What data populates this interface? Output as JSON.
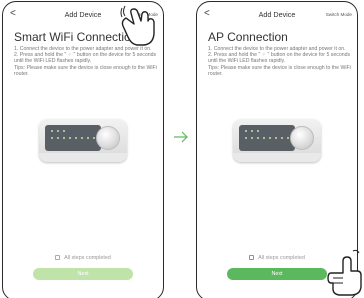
{
  "left_screen": {
    "back_label": "<",
    "title": "Add Device",
    "switch_mode_label": "Switch Mode",
    "heading": "Smart WiFi Connection",
    "instructions": "1. Connect the device to the power adapter and power it on.\n2. Press and hold the \" ⁘ \" button on the device for 5 seconds until the WiFi LED flashes rapidly.\nTips: Please make sure the device is close enough to the WiFi router.",
    "checkbox_label": "All steps completed",
    "checkbox_checked": false,
    "next_label": "Next",
    "next_enabled": false
  },
  "right_screen": {
    "back_label": "<",
    "title": "Add Device",
    "switch_mode_label": "Switch Mode",
    "heading": "AP Connection",
    "instructions": "1. Connect the device to the power adapter and power it on.\n2. Press and hold the \" ⁘ \" button on the device for 5 seconds until the WiFi LED flashes rapidly.\nTips: Please make sure the device is close enough to the WiFi router.",
    "checkbox_label": "All steps completed",
    "checkbox_checked": true,
    "next_label": "Next",
    "next_enabled": true
  },
  "arrow_icon": "arrow-right-icon",
  "colors": {
    "accent_green": "#5cb85c",
    "disabled_green": "#bfe3a8",
    "arrow_green": "#5cb85c"
  }
}
